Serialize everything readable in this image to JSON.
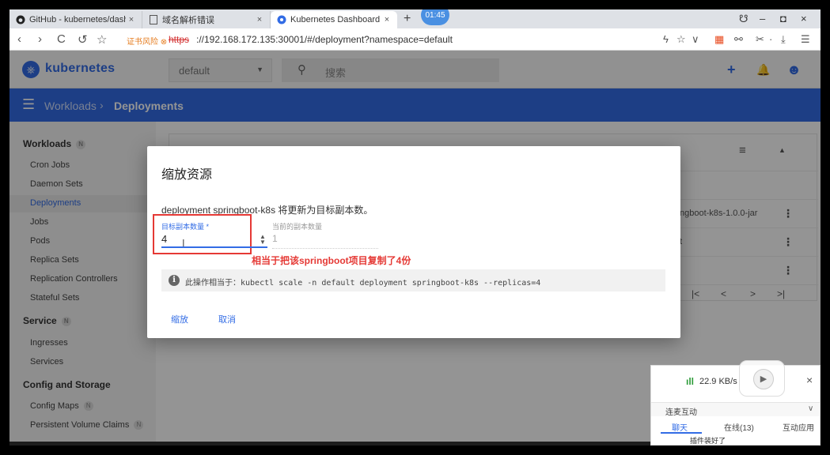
{
  "browser": {
    "tabs": [
      {
        "title": "GitHub - kubernetes/dashb",
        "icon": "github-icon",
        "close": "×"
      },
      {
        "title": "域名解析错误",
        "icon": "page-icon",
        "close": "×"
      },
      {
        "title": "Kubernetes Dashboard",
        "icon": "kubernetes-icon",
        "close": "×"
      }
    ],
    "new_tab": "+",
    "time_badge": "01:45",
    "window_controls": {
      "profile": "☋",
      "minimize": "–",
      "maximize": "◘",
      "close": "×"
    },
    "nav": {
      "back": "‹",
      "forward": "›",
      "reload": "C",
      "undo": "↺",
      "star": "☆"
    },
    "cert_warning": "证书风险 ⊗",
    "protocol": "https",
    "url": "://192.168.172.135:30001/#/deployment?namespace=default",
    "toolbar_right": [
      "ϟ",
      "☆",
      "∨",
      "▦",
      "⚯",
      "✂",
      "·",
      "⤓",
      "☰"
    ]
  },
  "header": {
    "logo_text": "kubernetes",
    "logo_glyph": "⎈",
    "namespace": "default",
    "namespace_chevron": "▼",
    "search_glyph": "⚲",
    "search_placeholder": "搜索",
    "add_glyph": "+",
    "bell_glyph": "🔔",
    "account_glyph": "☻"
  },
  "toolbar": {
    "menu_glyph": "☰",
    "crumb_workloads": "Workloads",
    "crumb_sep": "›",
    "crumb_deployments": "Deployments"
  },
  "sidebar": {
    "badge": "N",
    "sections": {
      "workloads": "Workloads",
      "service": "Service",
      "config": "Config and Storage"
    },
    "workload_items": [
      "Cron Jobs",
      "Daemon Sets",
      "Deployments",
      "Jobs",
      "Pods",
      "Replica Sets",
      "Replication Controllers",
      "Stateful Sets"
    ],
    "service_items": [
      "Ingresses",
      "Services"
    ],
    "config_items": [
      "Config Maps",
      "Persistent Volume Claims"
    ]
  },
  "content": {
    "filter_glyph": "≡",
    "collapse_glyph": "▲",
    "image_fragment": "ngboot-k8s-1.0.0-jar",
    "fragment_t": "t",
    "kebab": "⋮",
    "pagination": [
      "|<",
      "<",
      ">",
      ">|"
    ]
  },
  "dialog": {
    "title": "缩放资源",
    "description": "deployment springboot-k8s 将更新为目标副本数。",
    "target_label": "目标副本数量 *",
    "target_value": "4",
    "stepper_up": "▲",
    "stepper_down": "▼",
    "ibeam": "I",
    "current_label": "当前的副本数量",
    "current_value": "1",
    "annotation": "相当于把该springboot项目复制了4份",
    "info_glyph": "i",
    "command": "此操作相当于：kubectl scale -n default deployment springboot-k8s --replicas=4",
    "scale_button": "缩放",
    "cancel_button": "取消"
  },
  "chat": {
    "signal_glyph": "ıll",
    "speed": "22.9 KB/s",
    "close": "×",
    "section": "连麦互动",
    "chevron": "∨",
    "tabs": [
      "聊天",
      "在线(13)",
      "互动应用"
    ],
    "message": "插件装好了",
    "play_glyph": "▶"
  }
}
